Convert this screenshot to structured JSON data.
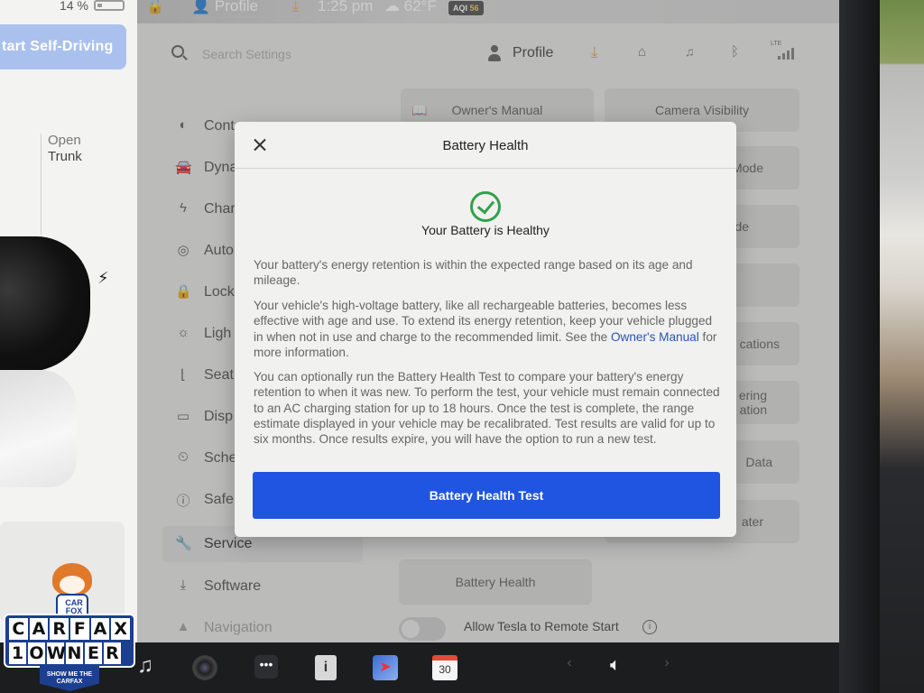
{
  "status_bar": {
    "battery_percent": "14 %",
    "profile": "Profile",
    "time": "1:25 pm",
    "temperature": "62°F",
    "aqi_label": "AQI",
    "aqi_value": "56"
  },
  "left_panel": {
    "self_driving_button": "tart Self-Driving",
    "open_label": "Open",
    "trunk_label": "Trunk"
  },
  "header": {
    "search_placeholder": "Search Settings",
    "profile": "Profile",
    "lte": "LTE"
  },
  "menu": [
    {
      "label": "Cont",
      "icon": "toggle-icon"
    },
    {
      "label": "Dyna",
      "icon": "car-icon"
    },
    {
      "label": "Char",
      "icon": "bolt-icon"
    },
    {
      "label": "Auto",
      "icon": "steering-wheel-icon"
    },
    {
      "label": "Lock",
      "icon": "lock-icon"
    },
    {
      "label": "Ligh",
      "icon": "sun-icon"
    },
    {
      "label": "Seat",
      "icon": "seat-icon"
    },
    {
      "label": "Disp",
      "icon": "display-icon"
    },
    {
      "label": "Sche",
      "icon": "clock-icon"
    },
    {
      "label": "Safe",
      "icon": "alert-icon"
    },
    {
      "label": "Service",
      "icon": "wrench-icon",
      "active": true
    },
    {
      "label": "Software",
      "icon": "download-icon"
    },
    {
      "label": "Navigation",
      "icon": "navigation-icon"
    }
  ],
  "grid_buttons": {
    "owners_manual": "Owner's Manual",
    "camera_visibility": "Camera Visibility",
    "right_2": "Mode",
    "right_3": "de",
    "right_5": "cations",
    "right_6a": "ering",
    "right_6b": "ation",
    "right_7": "Data",
    "right_8": "ater",
    "battery_health": "Battery Health"
  },
  "remote_start": {
    "label": "Allow Tesla to Remote Start",
    "enabled": false
  },
  "modal": {
    "title": "Battery Health",
    "status": "Your Battery is Healthy",
    "paragraph1": "Your battery's energy retention is within the expected range based on its age and mileage.",
    "paragraph2_before": "Your vehicle's high-voltage battery, like all rechargeable batteries, becomes less effective with age and use. To extend its energy retention, keep your vehicle plugged in when not in use and charge to the recommended limit. See the ",
    "paragraph2_link": "Owner's Manual",
    "paragraph2_after": " for more information.",
    "paragraph3": "You can optionally run the Battery Health Test to compare your battery's energy retention to when it was new. To perform the test, your vehicle must remain connected to an AC charging station for up to 18 hours. Once the test is complete, the range estimate displayed in your vehicle may be recalibrated. Test results are valid for up to six months. Once results expire, you will have the option to run a new test.",
    "test_button": "Battery Health Test"
  },
  "dock": {
    "calendar_day": "30"
  },
  "carfax": {
    "fox_label_1": "CAR",
    "fox_label_2": "FOX",
    "top_row": [
      "C",
      "A",
      "R",
      "F",
      "A",
      "X"
    ],
    "bottom_row": [
      "1",
      "O",
      "W",
      "N",
      "E",
      "R"
    ],
    "ribbon": "SHOW ME THE CARFAX"
  },
  "colors": {
    "accent_blue": "#1f55e0",
    "success_green": "#2fa24a",
    "link_blue": "#2853b8",
    "carfax_blue": "#1c3f8f"
  }
}
